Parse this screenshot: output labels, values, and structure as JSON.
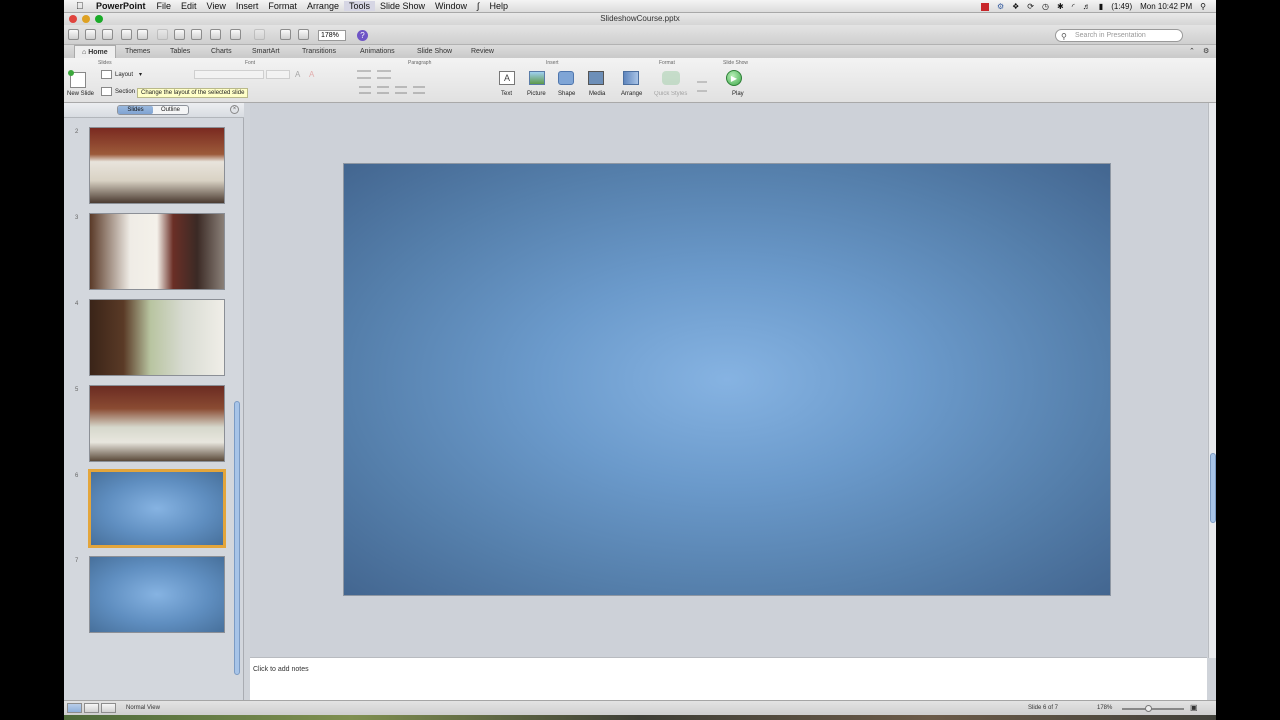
{
  "menubar": {
    "app_name": "PowerPoint",
    "menus": [
      "File",
      "Edit",
      "View",
      "Insert",
      "Format",
      "Arrange",
      "Tools",
      "Slide Show",
      "Window",
      "Help"
    ],
    "active_menu": "Tools",
    "battery": "(1:49)",
    "clock": "Mon 10:42 PM"
  },
  "window": {
    "title": "SlideshowCourse.pptx"
  },
  "toolbar": {
    "zoom": "178%",
    "search_placeholder": "Search in Presentation"
  },
  "ribbon_tabs": [
    "Home",
    "Themes",
    "Tables",
    "Charts",
    "SmartArt",
    "Transitions",
    "Animations",
    "Slide Show",
    "Review"
  ],
  "ribbon": {
    "groups": {
      "slides": "Slides",
      "font": "Font",
      "paragraph": "Paragraph",
      "insert": "Insert",
      "format": "Format",
      "slideshow": "Slide Show"
    },
    "new_slide": "New Slide",
    "layout": "Layout",
    "section": "Section",
    "text": "Text",
    "picture": "Picture",
    "shape": "Shape",
    "media": "Media",
    "arrange": "Arrange",
    "quick_styles": "Quick Styles",
    "play": "Play",
    "tooltip": "Change the layout of the selected slide"
  },
  "pane": {
    "tabs": [
      "Slides",
      "Outline"
    ],
    "active_tab": "Slides",
    "slides": [
      {
        "num": "2",
        "kind": "photo"
      },
      {
        "num": "3",
        "kind": "photo"
      },
      {
        "num": "4",
        "kind": "photo"
      },
      {
        "num": "5",
        "kind": "photo"
      },
      {
        "num": "6",
        "kind": "blank",
        "selected": true
      },
      {
        "num": "7",
        "kind": "blank"
      }
    ]
  },
  "notes": {
    "placeholder": "Click to add notes"
  },
  "status": {
    "view": "Normal View",
    "slide_pos": "Slide 6 of 7",
    "zoom": "178%"
  }
}
